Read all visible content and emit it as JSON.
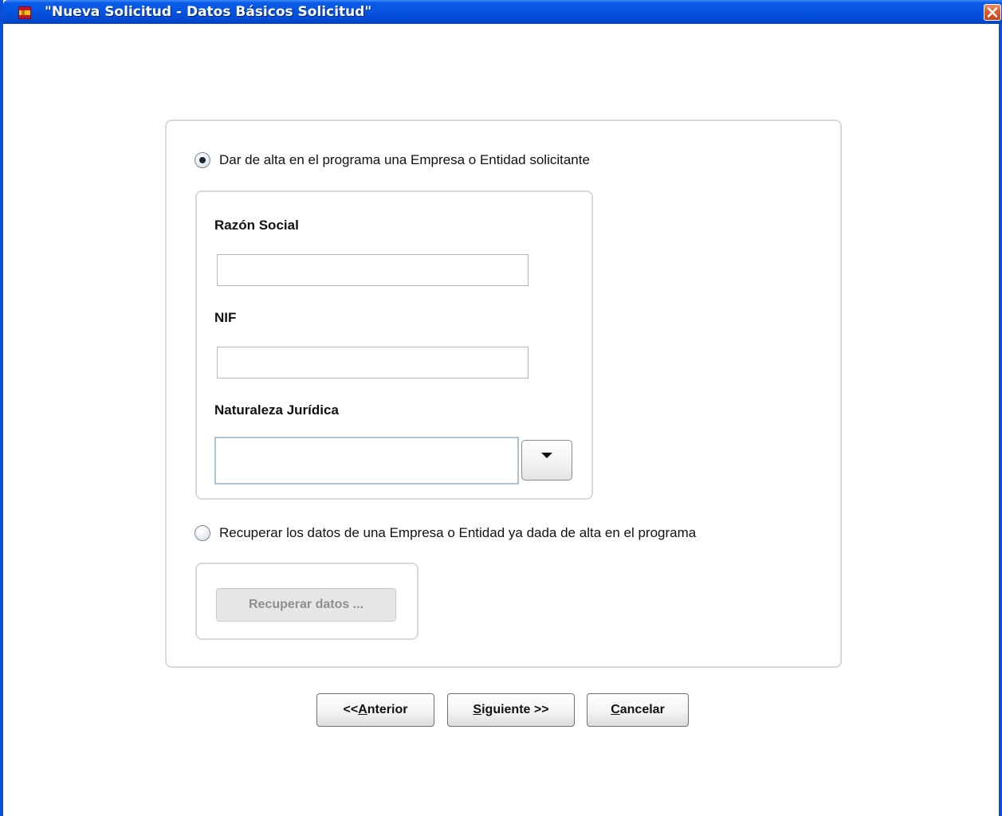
{
  "window": {
    "title": "\"Nueva Solicitud - Datos Básicos Solicitud\"",
    "icon": "spain-coat-of-arms-icon",
    "close_icon": "close-icon"
  },
  "option_new": {
    "label": "Dar de alta en el programa una Empresa o Entidad solicitante",
    "selected": true
  },
  "form": {
    "razon_social_label": "Razón Social",
    "razon_social_value": "",
    "nif_label": "NIF",
    "nif_value": "",
    "naturaleza_label": "Naturaleza Jurídica",
    "naturaleza_value": "",
    "dropdown_icon": "chevron-down-icon"
  },
  "option_recover": {
    "label": "Recuperar los datos de una Empresa o Entidad ya dada de alta en el programa",
    "selected": false,
    "button_label": "Recuperar datos ..."
  },
  "nav": {
    "prev_prefix": "<< ",
    "prev_mnemonic": "A",
    "prev_rest": "nterior",
    "next_mnemonic": "S",
    "next_rest": "iguiente >>",
    "cancel_mnemonic": "C",
    "cancel_rest": "ancelar"
  },
  "colors": {
    "titlebar": "#0654e0",
    "border": "#0a4fd6",
    "close": "#e15a2a"
  }
}
